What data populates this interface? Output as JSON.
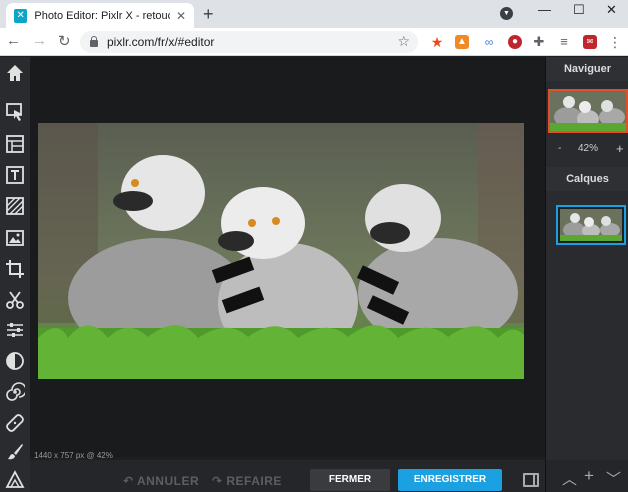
{
  "browser": {
    "tab_title": "Photo Editor: Pixlr X - retouche p",
    "tab_close": "✕",
    "new_tab": "+",
    "url": "pixlr.com/fr/x/#editor"
  },
  "editor": {
    "image_info": "1440 x 757 px @ 42%",
    "undo_label": "ANNULER",
    "redo_label": "REFAIRE",
    "close_label": "FERMER",
    "save_label": "ENREGISTRER"
  },
  "right_panel": {
    "navigator_title": "Naviguer",
    "zoom_minus": "-",
    "zoom_value": "42%",
    "zoom_plus": "+",
    "layers_title": "Calques"
  },
  "colors": {
    "accent": "#1ba1e2",
    "navigator_frame": "#e0512b"
  }
}
